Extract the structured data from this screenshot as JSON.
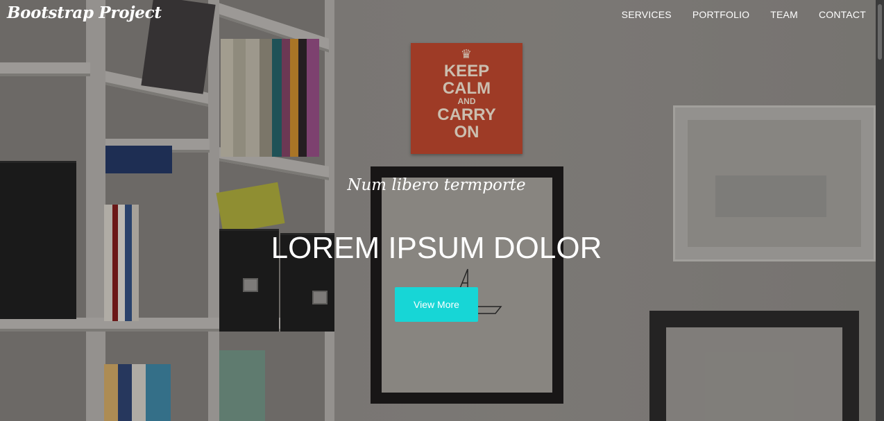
{
  "navbar": {
    "brand": "Bootstrap Project",
    "links": [
      "SERVICES",
      "PORTFOLIO",
      "TEAM",
      "CONTACT"
    ]
  },
  "hero": {
    "subheading": "Num libero termporte",
    "heading": "LOREM IPSUM DOLOR",
    "button_label": "View More",
    "background_image": "bookshelf-and-wall-frames",
    "poster_lines": [
      "KEEP",
      "CALM",
      "AND",
      "CARRY",
      "ON"
    ]
  },
  "colors": {
    "button": "#17d6d6",
    "text": "#ffffff"
  }
}
